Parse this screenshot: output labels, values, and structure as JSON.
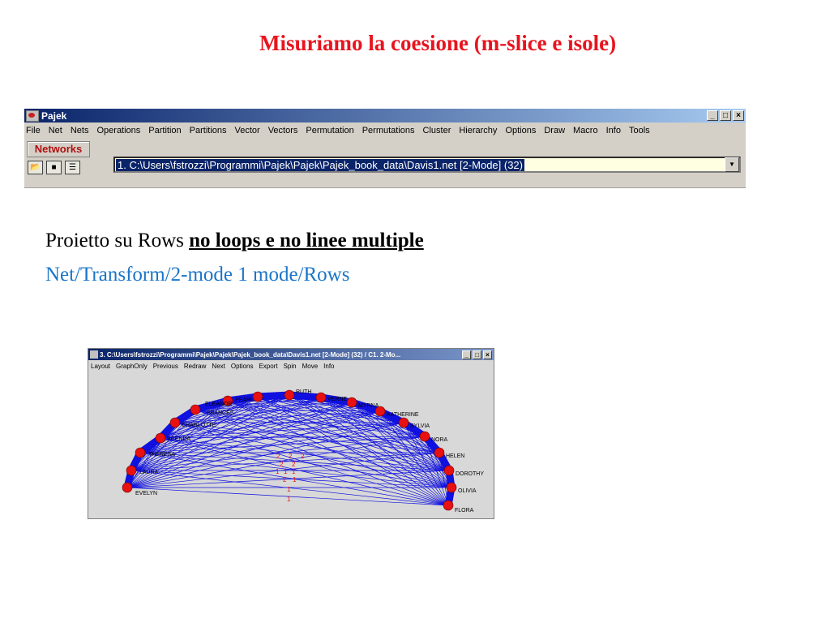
{
  "slide": {
    "title": "Misuriamo la coesione (m-slice e isole)",
    "line1_prefix": "Proietto su Rows ",
    "line1_bold": "no loops e no linee multiple",
    "line2": "Net/Transform/2-mode 1 mode/Rows"
  },
  "pajek": {
    "title": "Pajek",
    "window_buttons": [
      "_",
      "□",
      "×"
    ],
    "menu": [
      "File",
      "Net",
      "Nets",
      "Operations",
      "Partition",
      "Partitions",
      "Vector",
      "Vectors",
      "Permutation",
      "Permutations",
      "Cluster",
      "Hierarchy",
      "Options",
      "Draw",
      "Macro",
      "Info",
      "Tools"
    ],
    "networks_label": "Networks",
    "tool_icons": [
      "open-folder-icon",
      "save-disk-icon",
      "info-icon"
    ],
    "selected_network": "1. C:\\Users\\fstrozzi\\Programmi\\Pajek\\Pajek\\Pajek_book_data\\Davis1.net [2-Mode] (32)"
  },
  "draw_window": {
    "title": "3. C:\\Users\\fstrozzi\\Programmi\\Pajek\\Pajek\\Pajek_book_data\\Davis1.net [2-Mode] (32) / C1. 2-Mo...",
    "menu": [
      "Layout",
      "GraphOnly",
      "Previous",
      "Redraw",
      "Next",
      "Options",
      "Export",
      "Spin",
      "Move",
      "Info"
    ],
    "nodes": [
      "EVELYN",
      "LAURA",
      "THERESA",
      "BRENDA",
      "CHARLOTTE",
      "FRANCES",
      "ELEANOR",
      "PEARL",
      "RUTH",
      "VERNE",
      "MYRNA",
      "KATHERINE",
      "SYLVIA",
      "NORA",
      "HELEN",
      "DOROTHY",
      "OLIVIA",
      "FLORA"
    ],
    "edge_labels": [
      "2",
      "2",
      "2",
      "2",
      "2",
      "1",
      "1",
      "1",
      "2",
      "1",
      "1",
      "1"
    ],
    "colors": {
      "node": "#e81010",
      "edge": "#1010e0",
      "title_bar": "#0a246a"
    }
  }
}
